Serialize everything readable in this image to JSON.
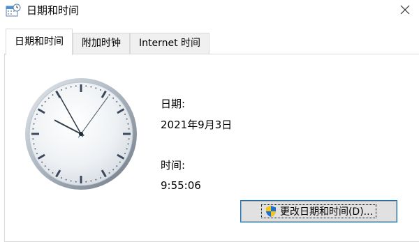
{
  "window": {
    "title": "日期和时间",
    "app_icon": "date-time-control-panel-icon",
    "close_icon": "close-icon"
  },
  "tabs": [
    {
      "label": "日期和时间",
      "active": true
    },
    {
      "label": "附加时钟",
      "active": false
    },
    {
      "label": "Internet 时间",
      "active": false
    }
  ],
  "date": {
    "label": "日期:",
    "value": "2021年9月3日"
  },
  "time": {
    "label": "时间:",
    "value": "9:55:06"
  },
  "clock": {
    "hours": 9,
    "minutes": 55,
    "seconds": 6
  },
  "change_button": {
    "label": "更改日期和时间(D)...",
    "icon": "uac-shield-icon"
  },
  "colors": {
    "tab_border": "#d9d9d9",
    "button_focus": "#0078d7"
  }
}
